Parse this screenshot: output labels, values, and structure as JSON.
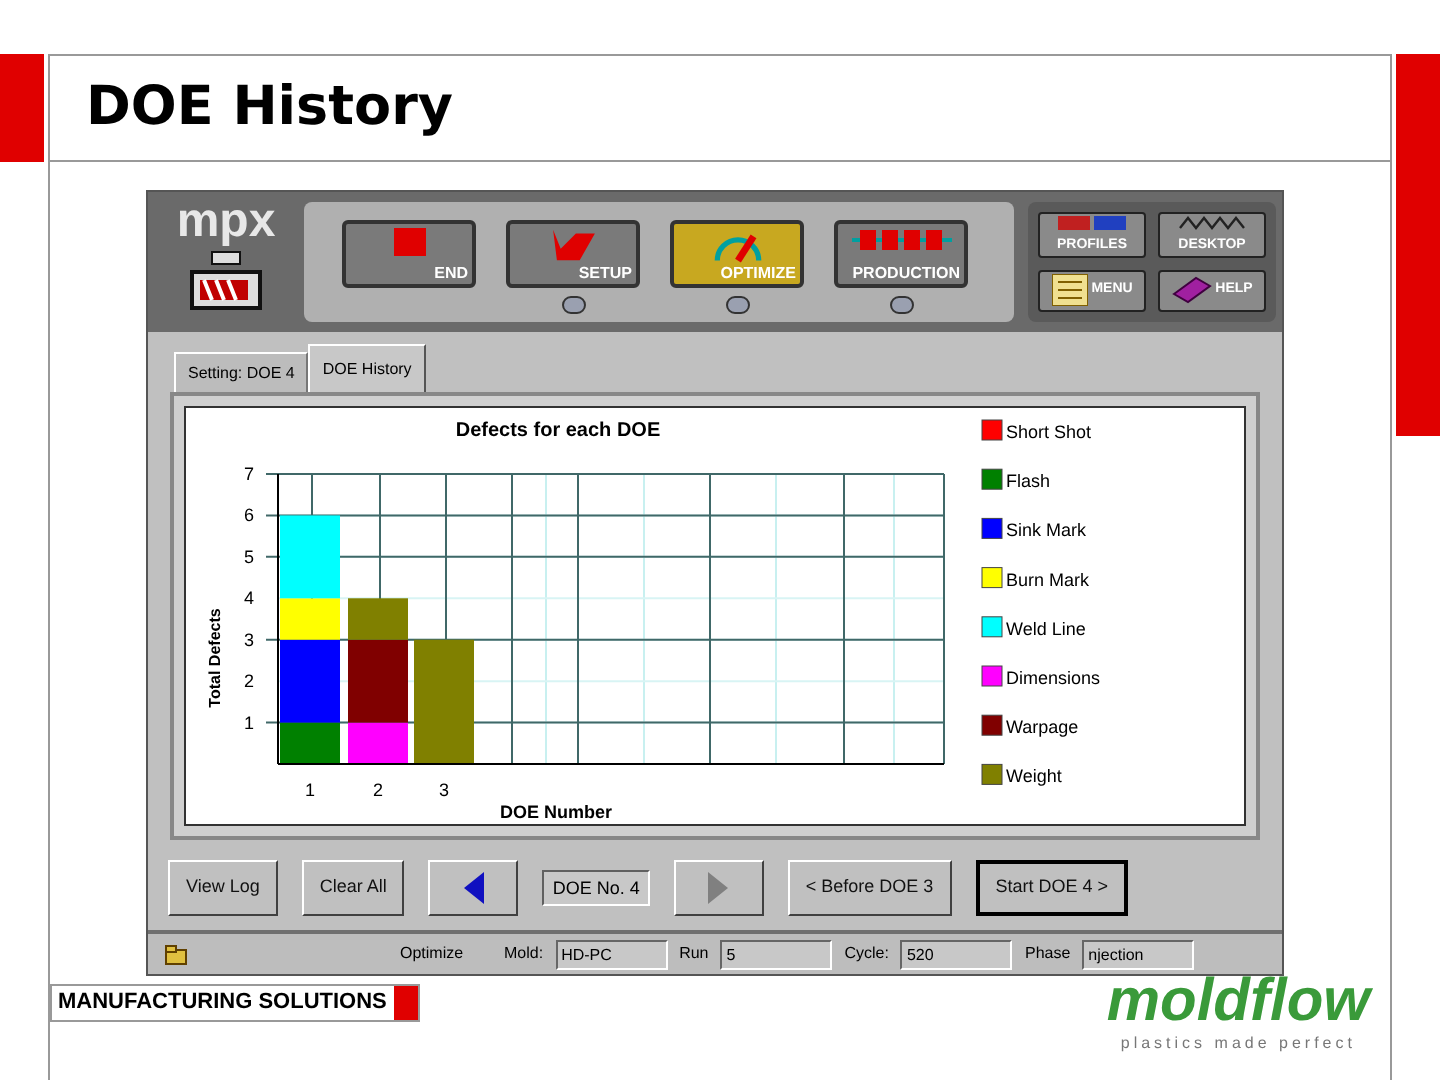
{
  "slide": {
    "title": "DOE History",
    "footer_label": "MANUFACTURING SOLUTIONS",
    "logo": {
      "name": "moldflow",
      "tagline": "plastics made perfect"
    }
  },
  "app": {
    "logo": "mpx",
    "toolbar": [
      {
        "label": "END",
        "kind": "end",
        "selected": false,
        "indicator": false
      },
      {
        "label": "SETUP",
        "kind": "setup",
        "selected": false,
        "indicator": true
      },
      {
        "label": "OPTIMIZE",
        "kind": "optimize",
        "selected": true,
        "indicator": true
      },
      {
        "label": "PRODUCTION",
        "kind": "production",
        "selected": false,
        "indicator": true
      }
    ],
    "side_buttons": [
      {
        "label": "PROFILES",
        "kind": "profiles"
      },
      {
        "label": "DESKTOP",
        "kind": "desktop"
      },
      {
        "label": "MENU",
        "kind": "menu"
      },
      {
        "label": "HELP",
        "kind": "help"
      }
    ],
    "tabs": [
      {
        "label": "Setting: DOE 4",
        "selected": false
      },
      {
        "label": "DOE History",
        "selected": true
      }
    ],
    "chart_data": {
      "type": "bar",
      "title": "Defects for each DOE",
      "xlabel": "DOE Number",
      "ylabel": "Total Defects",
      "categories": [
        "1",
        "2",
        "3"
      ],
      "stacked": true,
      "grid": true,
      "legend": true,
      "ylim": [
        0,
        7
      ],
      "yticks": [
        1,
        2,
        3,
        4,
        5,
        6,
        7
      ],
      "series": [
        {
          "name": "Short Shot",
          "color": "#ff0000",
          "values": [
            0,
            0,
            0
          ]
        },
        {
          "name": "Flash",
          "color": "#008000",
          "values": [
            1,
            0,
            0
          ]
        },
        {
          "name": "Sink Mark",
          "color": "#0000ff",
          "values": [
            2,
            0,
            0
          ]
        },
        {
          "name": "Burn Mark",
          "color": "#ffff00",
          "values": [
            1,
            0,
            0
          ]
        },
        {
          "name": "Weld Line",
          "color": "#00ffff",
          "values": [
            2,
            0,
            0
          ]
        },
        {
          "name": "Dimensions",
          "color": "#ff00ff",
          "values": [
            0,
            1,
            0
          ]
        },
        {
          "name": "Warpage",
          "color": "#800000",
          "values": [
            0,
            2,
            0
          ]
        },
        {
          "name": "Weight",
          "color": "#808000",
          "values": [
            0,
            1,
            3
          ]
        }
      ]
    },
    "buttons": [
      {
        "kind": "button",
        "label": "View Log",
        "default": false
      },
      {
        "kind": "button",
        "label": "Clear All",
        "default": false
      },
      {
        "kind": "prev",
        "disabled": false
      },
      {
        "kind": "field",
        "value": "DOE No. 4"
      },
      {
        "kind": "next",
        "disabled": true
      },
      {
        "kind": "button",
        "label": "< Before DOE 3",
        "default": false
      },
      {
        "kind": "button",
        "label": "Start DOE 4 >",
        "default": true
      }
    ],
    "status_bar": {
      "mode": "Optimize",
      "fields": [
        {
          "label": "Mold:",
          "value": "HD-PC"
        },
        {
          "label": "Run",
          "value": "5"
        },
        {
          "label": "Cycle:",
          "value": "520"
        },
        {
          "label": "Phase",
          "value": "njection"
        }
      ]
    }
  }
}
